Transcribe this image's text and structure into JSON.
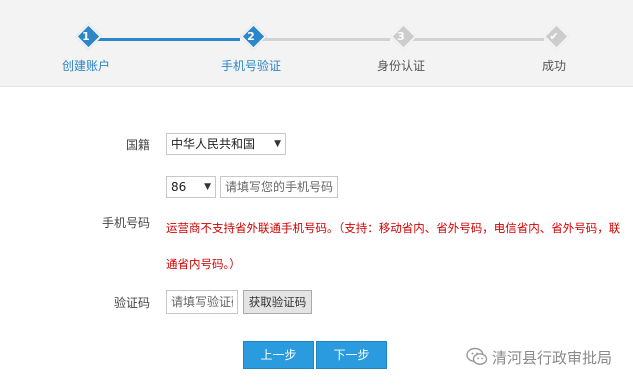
{
  "steps": [
    {
      "num": "1",
      "label": "创建账户",
      "state": "done"
    },
    {
      "num": "2",
      "label": "手机号验证",
      "state": "current"
    },
    {
      "num": "3",
      "label": "身份认证",
      "state": "pending"
    },
    {
      "num": "✔",
      "label": "成功",
      "state": "pending"
    }
  ],
  "form": {
    "nationality_label": "国籍",
    "nationality_value": "中华人民共和国",
    "country_code": "86",
    "phone_label": "手机号码",
    "phone_placeholder": "请填写您的手机号码",
    "phone_notice": "运营商不支持省外联通手机号码。（支持：移动省内、省外号码，电信省内、省外号码，联通省内号码。）",
    "code_label": "验证码",
    "code_placeholder": "请填写验证码",
    "get_code_button": "获取验证码"
  },
  "nav": {
    "prev": "上一步",
    "next": "下一步"
  },
  "watermark": {
    "text": "清河县行政审批局",
    "icon": "wechat-icon"
  },
  "colors": {
    "accent": "#2b87c8",
    "button": "#2b9be0",
    "warning": "#d40000"
  }
}
